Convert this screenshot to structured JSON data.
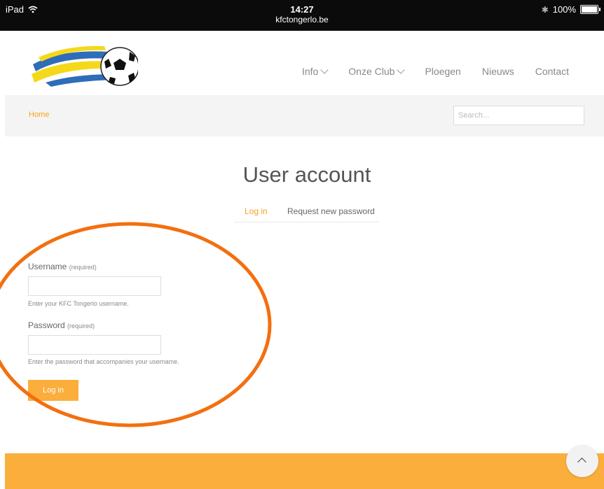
{
  "status_bar": {
    "device": "iPad",
    "time": "14:27",
    "url": "kfctongerlo.be",
    "battery": "100%"
  },
  "nav": {
    "items": [
      {
        "label": "Info",
        "dropdown": true
      },
      {
        "label": "Onze Club",
        "dropdown": true
      },
      {
        "label": "Ploegen",
        "dropdown": false
      },
      {
        "label": "Nieuws",
        "dropdown": false
      },
      {
        "label": "Contact",
        "dropdown": false
      }
    ]
  },
  "breadcrumb": {
    "home": "Home"
  },
  "search": {
    "placeholder": "Search..."
  },
  "page": {
    "title": "User account",
    "tabs": [
      {
        "label": "Log in",
        "active": true
      },
      {
        "label": "Request new password",
        "active": false
      }
    ]
  },
  "form": {
    "username_label": "Username",
    "username_required": "(required)",
    "username_hint": "Enter your KFC Tongerlo username.",
    "password_label": "Password",
    "password_required": "(required)",
    "password_hint": "Enter the password that accompanies your username.",
    "submit_label": "Log in"
  },
  "colors": {
    "accent": "#f7a21b",
    "button": "#fbae3c",
    "annotation": "#f36f10"
  },
  "icons": {
    "wifi": "wifi-icon",
    "bluetooth": "bluetooth-icon",
    "battery": "battery-icon",
    "back_to_top": "chevron-up-icon"
  }
}
